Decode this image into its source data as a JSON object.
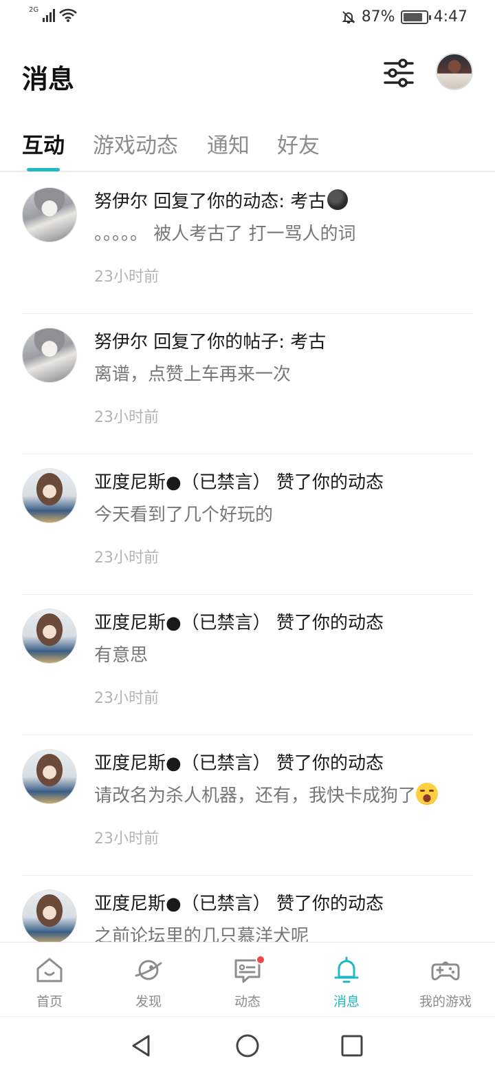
{
  "status_bar": {
    "network": "2G",
    "battery_percent": "87%",
    "battery_level": 0.87,
    "time": "4:47"
  },
  "header": {
    "title": "消息"
  },
  "tabs": [
    {
      "label": "互动",
      "active": true
    },
    {
      "label": "游戏动态",
      "active": false
    },
    {
      "label": "通知",
      "active": false
    },
    {
      "label": "好友",
      "active": false
    }
  ],
  "messages": [
    {
      "title": "努伊尔 回复了你的动态: 考古",
      "title_emoji": "dark-face-emoji",
      "body": "。。。。。 被人考古了 打一骂人的词",
      "time": "23小时前"
    },
    {
      "title": "努伊尔 回复了你的帖子: 考古",
      "body": "离谱，点赞上车再来一次",
      "time": "23小时前"
    },
    {
      "title": "亚度尼斯●（已禁言） 赞了你的动态",
      "body": "今天看到了几个好玩的",
      "time": "23小时前"
    },
    {
      "title": "亚度尼斯●（已禁言） 赞了你的动态",
      "body": "有意思",
      "time": "23小时前"
    },
    {
      "title": "亚度尼斯●（已禁言） 赞了你的动态",
      "body": "请改名为杀人机器，还有，我快卡成狗了",
      "body_emoji": "laughing-tears-emoji",
      "time": "23小时前"
    },
    {
      "title": "亚度尼斯●（已禁言） 赞了你的动态",
      "body": "之前论坛里的几只慕洋犬呢",
      "time": ""
    }
  ],
  "bottom_nav": [
    {
      "label": "首页",
      "icon": "home-icon",
      "active": false
    },
    {
      "label": "发现",
      "icon": "planet-icon",
      "active": false
    },
    {
      "label": "动态",
      "icon": "chat-icon",
      "active": false,
      "badge": true
    },
    {
      "label": "消息",
      "icon": "bell-icon",
      "active": true
    },
    {
      "label": "我的游戏",
      "icon": "gamepad-icon",
      "active": false
    }
  ],
  "colors": {
    "accent": "#21b8c4",
    "badge": "#f04848",
    "text": "#1a1a1a",
    "muted": "#8c8c8c"
  }
}
